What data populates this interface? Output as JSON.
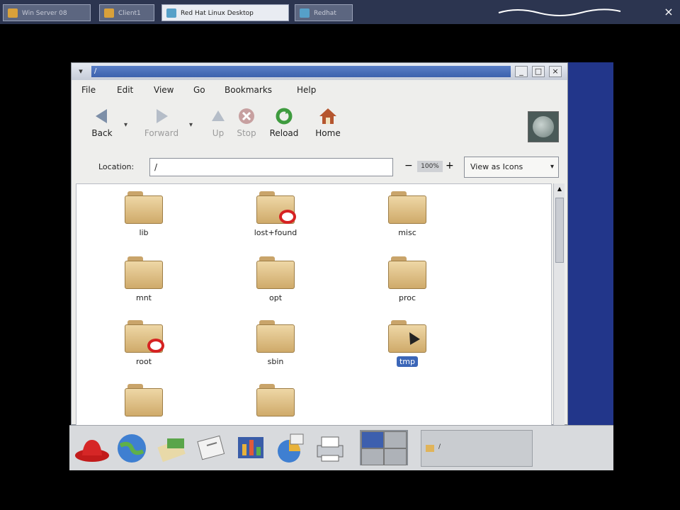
{
  "host_tabs": [
    {
      "label": "Win Server 08",
      "active": false
    },
    {
      "label": "Client1",
      "active": false
    },
    {
      "label": "Red Hat Linux Desktop",
      "active": true
    },
    {
      "label": "Redhat",
      "active": false
    }
  ],
  "host_close": "×",
  "window": {
    "menu_glyph": "▾",
    "title": "/",
    "buttons": {
      "minimize": "_",
      "maximize": "□",
      "close": "×"
    }
  },
  "menubar": [
    "File",
    "Edit",
    "View",
    "Go",
    "Bookmarks",
    "Help"
  ],
  "toolbar": {
    "back": "Back",
    "forward": "Forward",
    "up": "Up",
    "stop": "Stop",
    "reload": "Reload",
    "home": "Home"
  },
  "location": {
    "label": "Location:",
    "value": "/",
    "zoom_out": "−",
    "zoom_level": "100%",
    "zoom_in": "+",
    "view_mode": "View as Icons"
  },
  "files": [
    {
      "name": "lib",
      "locked": false,
      "selected": false
    },
    {
      "name": "lost+found",
      "locked": true,
      "selected": false
    },
    {
      "name": "misc",
      "locked": false,
      "selected": false
    },
    {
      "name": "mnt",
      "locked": false,
      "selected": false
    },
    {
      "name": "opt",
      "locked": false,
      "selected": false
    },
    {
      "name": "proc",
      "locked": false,
      "selected": false
    },
    {
      "name": "root",
      "locked": true,
      "selected": false
    },
    {
      "name": "sbin",
      "locked": false,
      "selected": false
    },
    {
      "name": "tmp",
      "locked": false,
      "selected": true
    },
    {
      "name": "",
      "locked": false,
      "selected": false
    },
    {
      "name": "",
      "locked": false,
      "selected": false
    }
  ],
  "taskbar": {
    "launchers": [
      "redhat-menu-icon",
      "web-browser-icon",
      "email-icon",
      "writer-icon",
      "presentation-icon",
      "spreadsheet-icon",
      "print-manager-icon"
    ],
    "tasklist_text": "/"
  },
  "colors": {
    "accent": "#3b66b8",
    "desktop": "#22368a"
  }
}
